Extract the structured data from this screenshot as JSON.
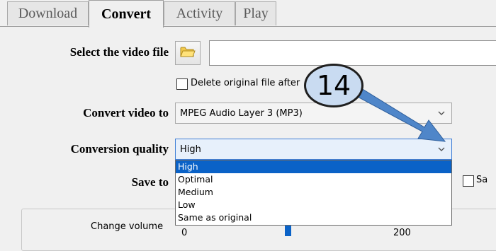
{
  "tabs": [
    {
      "label": "Download",
      "active": false
    },
    {
      "label": "Convert",
      "active": true
    },
    {
      "label": "Activity",
      "active": false
    },
    {
      "label": "Play",
      "active": false
    }
  ],
  "form": {
    "select_video_label": "Select the video file",
    "file_path_value": "",
    "delete_original_label": "Delete original file after",
    "delete_original_checked": false,
    "convert_to_label": "Convert video to",
    "convert_to_value": "MPEG Audio Layer 3 (MP3)",
    "quality_label": "Conversion quality",
    "quality_value": "High",
    "quality_options": [
      "High",
      "Optimal",
      "Medium",
      "Low",
      "Same as original"
    ],
    "quality_selected_index": 0,
    "save_to_label": "Save to",
    "same_checkbox_label": "Sa",
    "same_checkbox_checked": false
  },
  "volume": {
    "label": "Change volume",
    "min_value": "0",
    "max_value": "200"
  },
  "annotation": {
    "number": "14",
    "circle_fill": "#c9dbf1",
    "arrow_color": "#4f86c9"
  },
  "icons": {
    "folder": "folder-icon",
    "chevron": "chevron-down-icon"
  }
}
